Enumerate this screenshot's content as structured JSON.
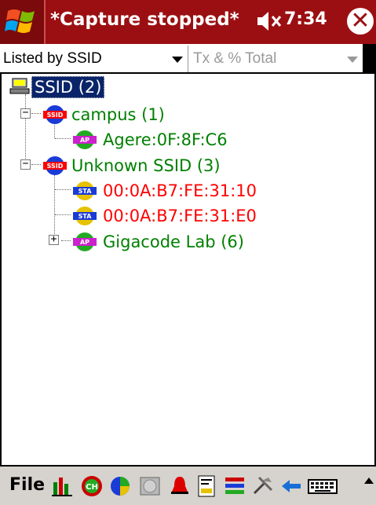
{
  "titlebar": {
    "title": "*Capture stopped*",
    "time": "7:34",
    "colors": {
      "background": "#9b0f12"
    }
  },
  "filters": {
    "group_by": "Listed by SSID",
    "column_placeholder": "Tx & % Total"
  },
  "tree": {
    "root": "SSID (2)",
    "nodes": [
      {
        "label": "campus (1)",
        "type": "SSID",
        "color": "#008000"
      },
      {
        "label": "Agere:0F:8F:C6",
        "type": "AP",
        "color": "#008000"
      },
      {
        "label": "Unknown SSID (3)",
        "type": "SSID",
        "color": "#008000"
      },
      {
        "label": "00:0A:B7:FE:31:10",
        "type": "STA",
        "color": "#ff0000"
      },
      {
        "label": "00:0A:B7:FE:31:E0",
        "type": "STA",
        "color": "#ff0000"
      },
      {
        "label": "Gigacode Lab (6)",
        "type": "AP",
        "color": "#008000"
      }
    ],
    "icon_labels": {
      "ssid": "SSID",
      "ap": "AP",
      "sta": "STA"
    }
  },
  "toolbar": {
    "file_label": "File",
    "icons": [
      "bars-icon",
      "channel-icon",
      "pie-icon",
      "disk-icon",
      "bell-icon",
      "report-icon",
      "color-bars-icon",
      "tools-icon",
      "back-arrow-icon",
      "keyboard-icon"
    ],
    "channel_text": "CH"
  }
}
